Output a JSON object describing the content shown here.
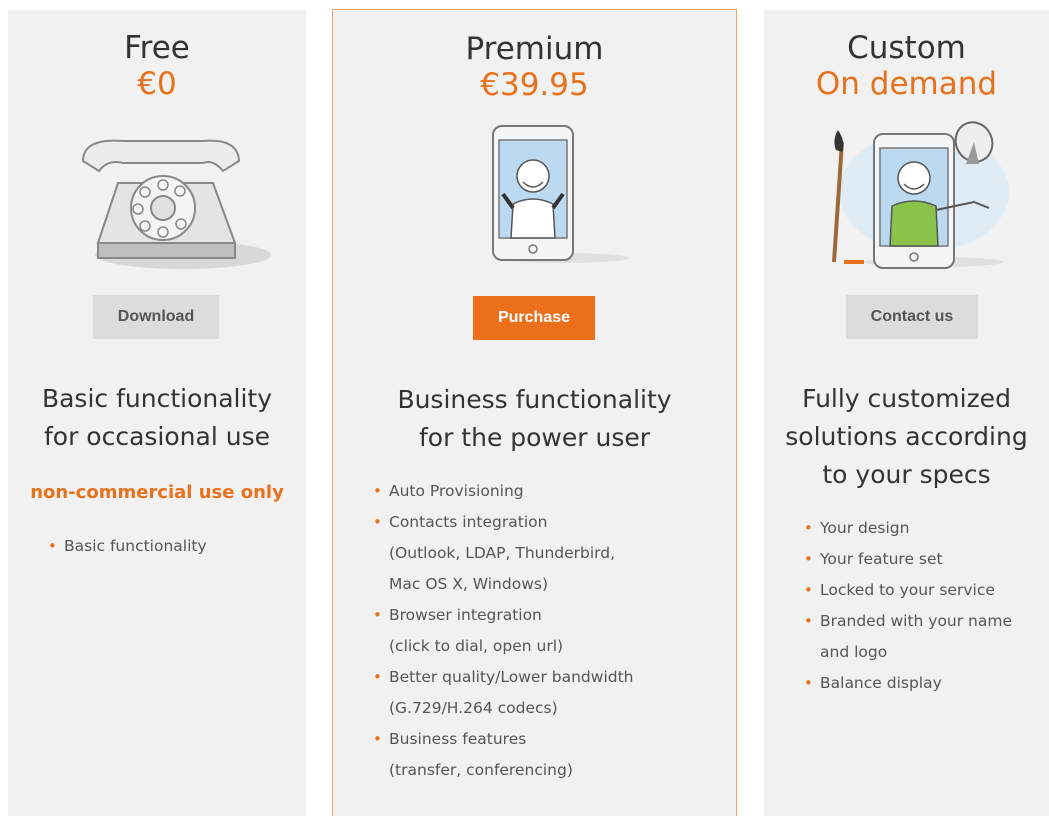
{
  "plans": [
    {
      "name": "Free",
      "price": "€0",
      "button": "Download",
      "tagline_lines": [
        "Basic functionality",
        "for occasional use"
      ],
      "note": "non-commercial use only",
      "features": [
        {
          "line1": "Basic functionality"
        }
      ],
      "illustration": "rotary-telephone"
    },
    {
      "name": "Premium",
      "price": "€39.95",
      "button": "Purchase",
      "tagline_lines": [
        "Business functionality",
        "for the power user"
      ],
      "features": [
        {
          "line1": "Auto Provisioning"
        },
        {
          "line1": "Contacts integration",
          "line2": "(Outlook, LDAP, Thunderbird,",
          "line3": "Mac OS X, Windows)"
        },
        {
          "line1": "Browser integration",
          "line2": "(click to dial, open url)"
        },
        {
          "line1": "Better quality/Lower bandwidth",
          "line2": "(G.729/H.264 codecs)"
        },
        {
          "line1": "Business features",
          "line2": "(transfer, conferencing)"
        }
      ],
      "illustration": "smartphone-with-character"
    },
    {
      "name": "Custom",
      "price": "On demand",
      "button": "Contact us",
      "tagline_lines": [
        "Fully customized",
        "solutions according",
        "to your specs"
      ],
      "features": [
        {
          "line1": "Your design"
        },
        {
          "line1": "Your feature set"
        },
        {
          "line1": "Locked to your service"
        },
        {
          "line1": "Branded with your name",
          "line2": "and logo"
        },
        {
          "line1": "Balance display"
        }
      ],
      "illustration": "smartphone-with-paintbrush-and-satellite-dish"
    }
  ],
  "bullet": "•",
  "colors": {
    "accent": "#ec6f1b",
    "panel": "#f1f1f1",
    "button_grey": "#dcdcdc",
    "border_accent": "#f0a26a"
  }
}
